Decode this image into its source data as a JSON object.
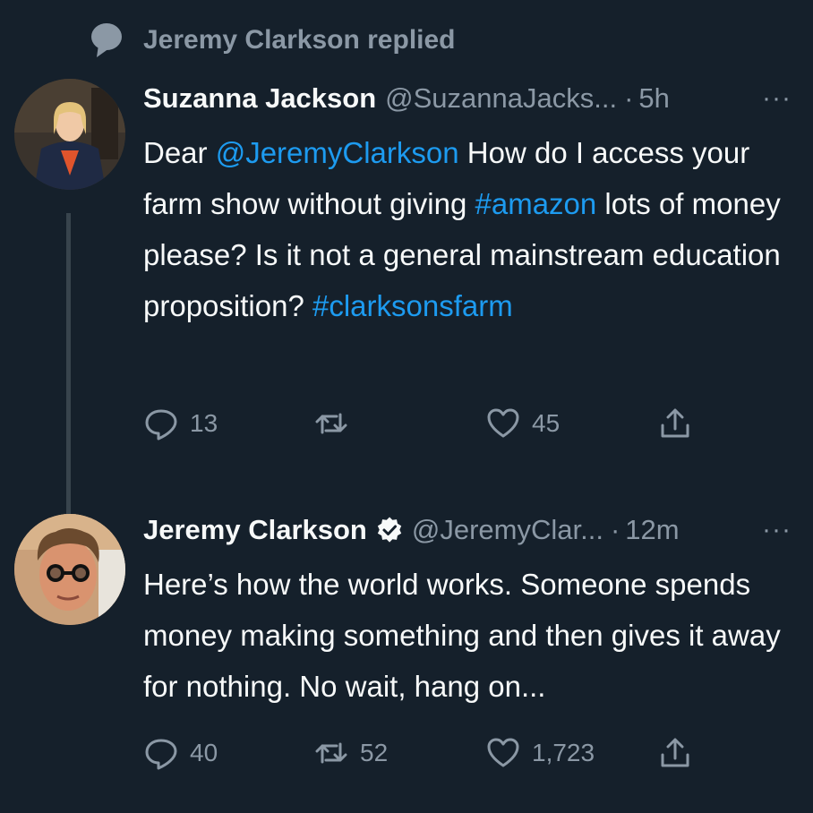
{
  "context": {
    "icon": "speech-bubble-icon",
    "text": "Jeremy Clarkson replied"
  },
  "tweets": [
    {
      "name": "Suzanna Jackson",
      "handle": "@SuzannaJacks...",
      "sep": "·",
      "time": "5h",
      "more": "···",
      "text_parts": {
        "p1": "Dear ",
        "mention": "@JeremyClarkson",
        "p2": " How do I access your farm show without giving ",
        "hashtag1": "#amazon",
        "p3": " lots of money please? Is it not a general mainstream education proposition? ",
        "hashtag2": "#clarksonsfarm"
      },
      "actions": {
        "replies": "13",
        "retweets": "",
        "likes": "45"
      }
    },
    {
      "name": "Jeremy Clarkson",
      "verified": true,
      "handle": "@JeremyClar...",
      "sep": "·",
      "time": "12m",
      "more": "···",
      "text": "Here’s how the world works. Someone spends money making something and then gives it away for nothing. No wait, hang on...",
      "actions": {
        "replies": "40",
        "retweets": "52",
        "likes": "1,723"
      }
    }
  ],
  "colors": {
    "background": "#15202b",
    "link": "#1d9bf0",
    "muted": "#8b98a5",
    "text": "#f7f9f9"
  }
}
